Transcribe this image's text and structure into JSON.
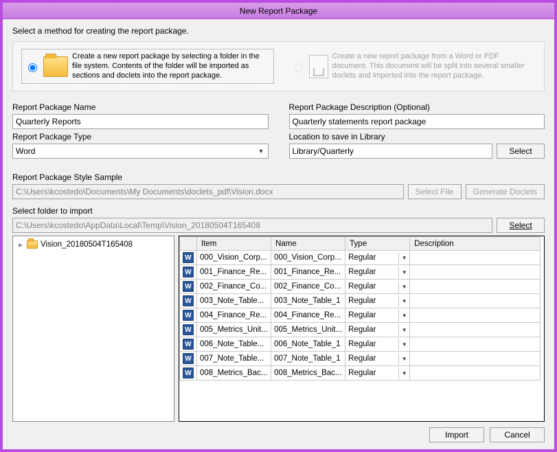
{
  "window": {
    "title": "New Report Package"
  },
  "instr": "Select a method for creating the report package.",
  "method": {
    "opt1": "Create a new report package by selecting a folder in the file system. Contents of the folder will be imported as sections and doclets into the report package.",
    "opt2": "Create a new report package from a Word or PDF document. This document will be split into several smaller doclets and imported into the report package."
  },
  "labels": {
    "pkg_name": "Report Package Name",
    "pkg_desc": "Report Package Description (Optional)",
    "pkg_type": "Report Package Type",
    "location": "Location to save in Library",
    "style": "Report Package Style Sample",
    "folder": "Select folder to import"
  },
  "values": {
    "pkg_name": "Quarterly Reports",
    "pkg_desc": "Quarterly statements report package",
    "pkg_type": "Word",
    "location": "Library/Quarterly",
    "style_path": "C:\\Users\\kcostedo\\Documents\\My Documents\\doclets_pdf\\Vision.docx",
    "folder_path": "C:\\Users\\kcostedo\\AppData\\Local\\Temp\\Vision_20180504T165408"
  },
  "buttons": {
    "select": "Select",
    "select_file": "Select File",
    "generate": "Generate Doclets",
    "import": "Import",
    "cancel": "Cancel"
  },
  "tree": {
    "root": "Vision_20180504T165408"
  },
  "grid": {
    "headers": {
      "item": "Item",
      "name": "Name",
      "type": "Type",
      "desc": "Description"
    },
    "rows": [
      {
        "item": "000_Vision_Corp...",
        "name": "000_Vision_Corp...",
        "type": "Regular",
        "desc": ""
      },
      {
        "item": "001_Finance_Re...",
        "name": "001_Finance_Re...",
        "type": "Regular",
        "desc": ""
      },
      {
        "item": "002_Finance_Co...",
        "name": "002_Finance_Co...",
        "type": "Regular",
        "desc": ""
      },
      {
        "item": "003_Note_Table...",
        "name": "003_Note_Table_1",
        "type": "Regular",
        "desc": ""
      },
      {
        "item": "004_Finance_Re...",
        "name": "004_Finance_Re...",
        "type": "Regular",
        "desc": ""
      },
      {
        "item": "005_Metrics_Unit...",
        "name": "005_Metrics_Unit...",
        "type": "Regular",
        "desc": ""
      },
      {
        "item": "006_Note_Table...",
        "name": "006_Note_Table_1",
        "type": "Regular",
        "desc": ""
      },
      {
        "item": "007_Note_Table...",
        "name": "007_Note_Table_1",
        "type": "Regular",
        "desc": ""
      },
      {
        "item": "008_Metrics_Bac...",
        "name": "008_Metrics_Bac...",
        "type": "Regular",
        "desc": ""
      }
    ]
  }
}
